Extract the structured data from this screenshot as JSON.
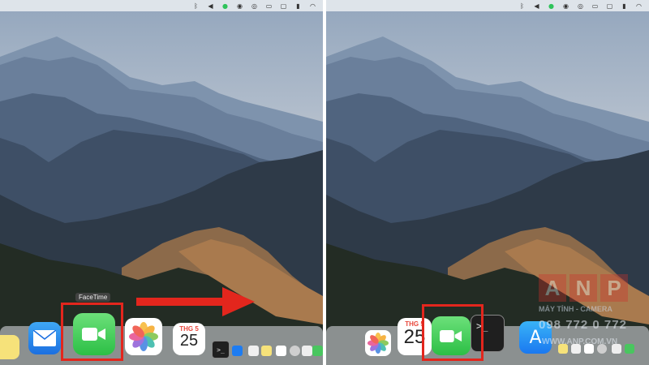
{
  "menubar": {
    "icons": [
      "bluetooth-icon",
      "volume-icon",
      "facetime-status-icon",
      "record-icon",
      "focus-icon",
      "airplay-icon",
      "display-icon",
      "battery-icon",
      "wifi-icon"
    ]
  },
  "left_panel": {
    "tooltip": "FaceTime",
    "dock_apps": [
      "Notes",
      "Mail",
      "FaceTime",
      "Photos",
      "Calendar",
      "Terminal",
      "App Store"
    ],
    "calendar": {
      "month": "THG 5",
      "day": "25"
    }
  },
  "right_panel": {
    "dock_apps": [
      "Photos",
      "Calendar",
      "FaceTime",
      "Terminal",
      "App Store"
    ],
    "calendar": {
      "month": "THG 5",
      "day": "25"
    }
  },
  "arrow": {
    "color": "#e3261d"
  },
  "highlight": {
    "color": "#e3261d"
  },
  "watermark": {
    "letters": [
      "A",
      "N",
      "P"
    ],
    "line1": "MÁY TÍNH - CAMERA",
    "phone": "098 772 0 772",
    "website": "WWW.ANP.COM.VN"
  }
}
